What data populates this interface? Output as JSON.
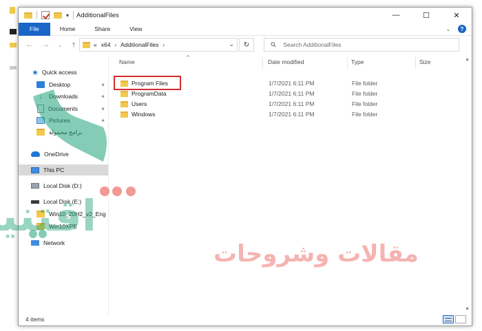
{
  "window": {
    "title": "AdditionalFiles",
    "controls": {
      "minimize": "—",
      "maximize": "☐",
      "close": "✕"
    }
  },
  "ribbon": {
    "tabs": [
      "File",
      "Home",
      "Share",
      "View"
    ]
  },
  "address": {
    "prefix": "«",
    "crumbs": [
      "x64",
      "AdditionalFiles"
    ],
    "separator": "›"
  },
  "search": {
    "placeholder": "Search AdditionalFiles"
  },
  "nav": {
    "quick_access": "Quick access",
    "items": [
      "Desktop",
      "Downloads",
      "Documents",
      "Pictures",
      "برامج محمولة"
    ],
    "onedrive": "OneDrive",
    "this_pc": "This PC",
    "local_d": "Local Disk (D:)",
    "local_e": "Local Disk (E:)",
    "e_children": [
      "Win10_20H2_v2_Eng",
      "Win10XPE"
    ],
    "network": "Network"
  },
  "columns": {
    "name": "Name",
    "date": "Date modified",
    "type": "Type",
    "size": "Size"
  },
  "files": [
    {
      "name": "Program Files",
      "date": "1/7/2021 6:11 PM",
      "type": "File folder"
    },
    {
      "name": "ProgramData",
      "date": "1/7/2021 6:11 PM",
      "type": "File folder"
    },
    {
      "name": "Users",
      "date": "1/7/2021 6:11 PM",
      "type": "File folder"
    },
    {
      "name": "Windows",
      "date": "1/7/2021 6:11 PM",
      "type": "File folder"
    }
  ],
  "status": {
    "item_count": "4 items"
  },
  "watermark": {
    "brand": "اقتنيي",
    "tagline": "مقالات وشروحات"
  },
  "colors": {
    "accent": "#1a66c7",
    "highlight": "#d42b2b",
    "folder": "#f2c94c",
    "watermark_green": "#1fa37a",
    "watermark_red": "#e8473f"
  }
}
